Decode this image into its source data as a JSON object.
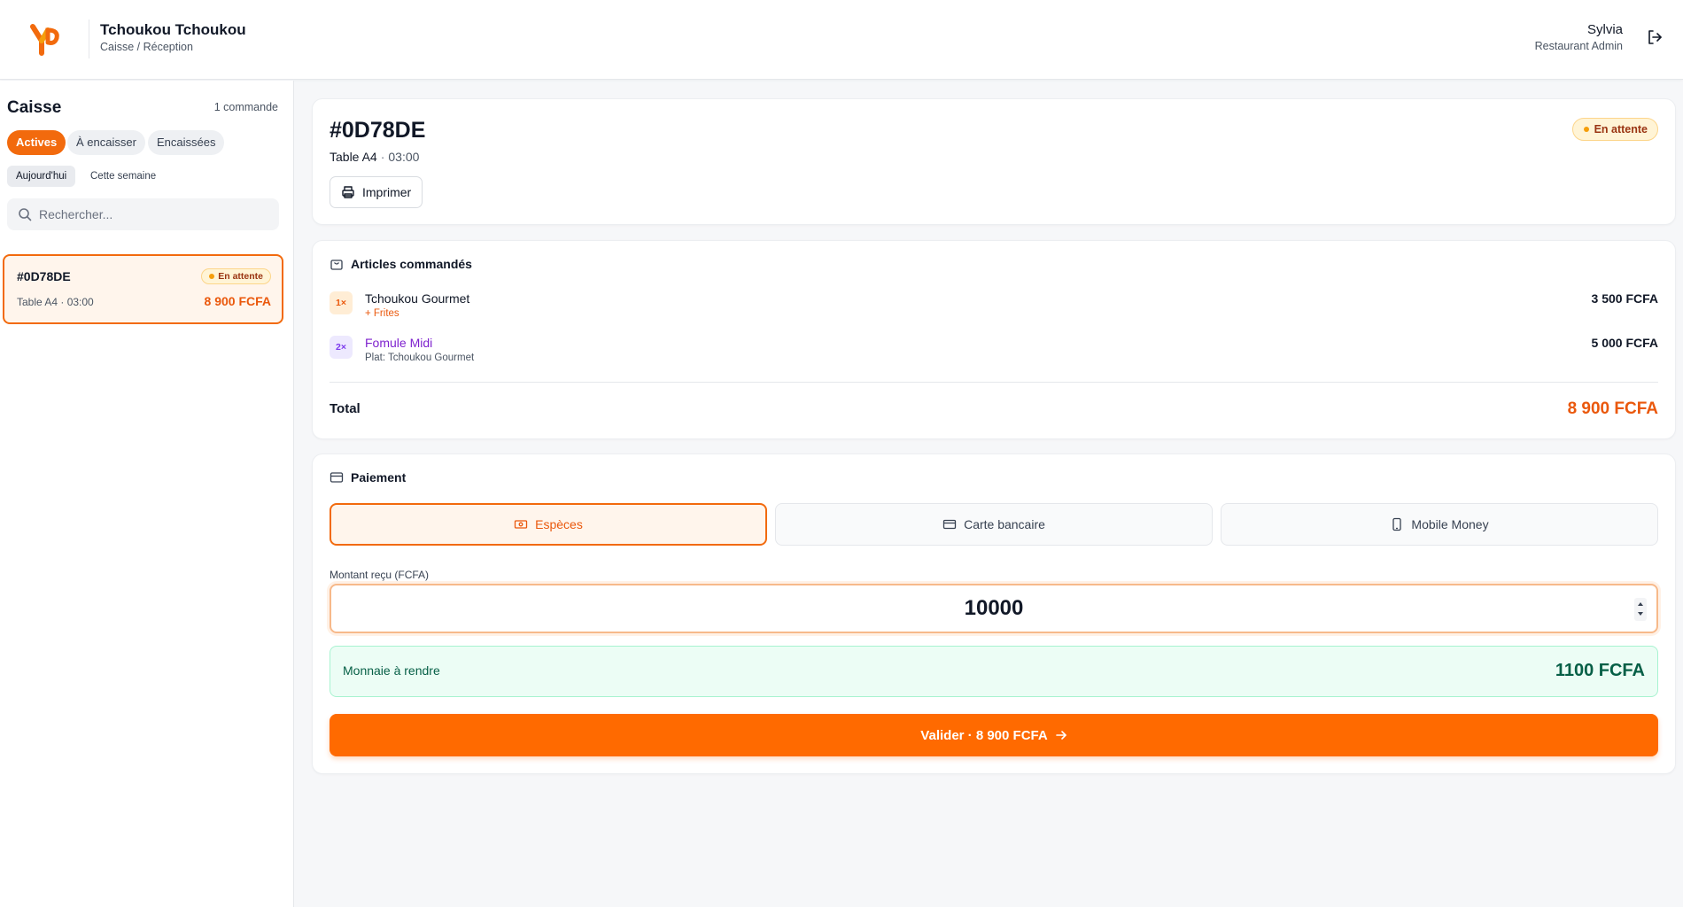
{
  "header": {
    "brand_name": "Tchoukou Tchoukou",
    "brand_sub": "Caisse / Réception",
    "user_name": "Sylvia",
    "user_role": "Restaurant Admin",
    "accent_color": "#f26a0d"
  },
  "sidebar": {
    "title": "Caisse",
    "count": "1 commande",
    "status_tabs": [
      {
        "label": "Actives",
        "active": true
      },
      {
        "label": "À encaisser",
        "active": false
      },
      {
        "label": "Encaissées",
        "active": false
      }
    ],
    "period_tabs": [
      {
        "label": "Aujourd'hui",
        "active": true
      },
      {
        "label": "Cette semaine",
        "active": false
      }
    ],
    "search_placeholder": "Rechercher...",
    "orders": [
      {
        "id": "#0D78DE",
        "meta": "Table A4 · 03:00",
        "status": "En attente",
        "amount": "8 900 FCFA",
        "selected": true
      }
    ]
  },
  "order": {
    "id": "#0D78DE",
    "table": "Table A4",
    "separator": "·",
    "time": "03:00",
    "status": "En attente",
    "print_label": "Imprimer"
  },
  "items_section": {
    "title": "Articles commandés",
    "items": [
      {
        "qty": "1×",
        "name": "Tchoukou Gourmet",
        "sub": "+ Frites",
        "price": "3 500 FCFA"
      },
      {
        "qty": "2×",
        "name": "Fomule Midi",
        "sub": "Plat: Tchoukou Gourmet",
        "price": "5 000 FCFA"
      }
    ],
    "total_label": "Total",
    "total_amount": "8 900 FCFA"
  },
  "payment": {
    "title": "Paiement",
    "methods": [
      {
        "label": "Espèces",
        "icon": "cash-icon",
        "active": true
      },
      {
        "label": "Carte bancaire",
        "icon": "credit-card-icon",
        "active": false
      },
      {
        "label": "Mobile Money",
        "icon": "smartphone-icon",
        "active": false
      }
    ],
    "amount_label": "Montant reçu (FCFA)",
    "amount_value": "10000",
    "change_label": "Monnaie à rendre",
    "change_amount": "1100 FCFA",
    "validate_label": "Valider · 8 900 FCFA"
  }
}
